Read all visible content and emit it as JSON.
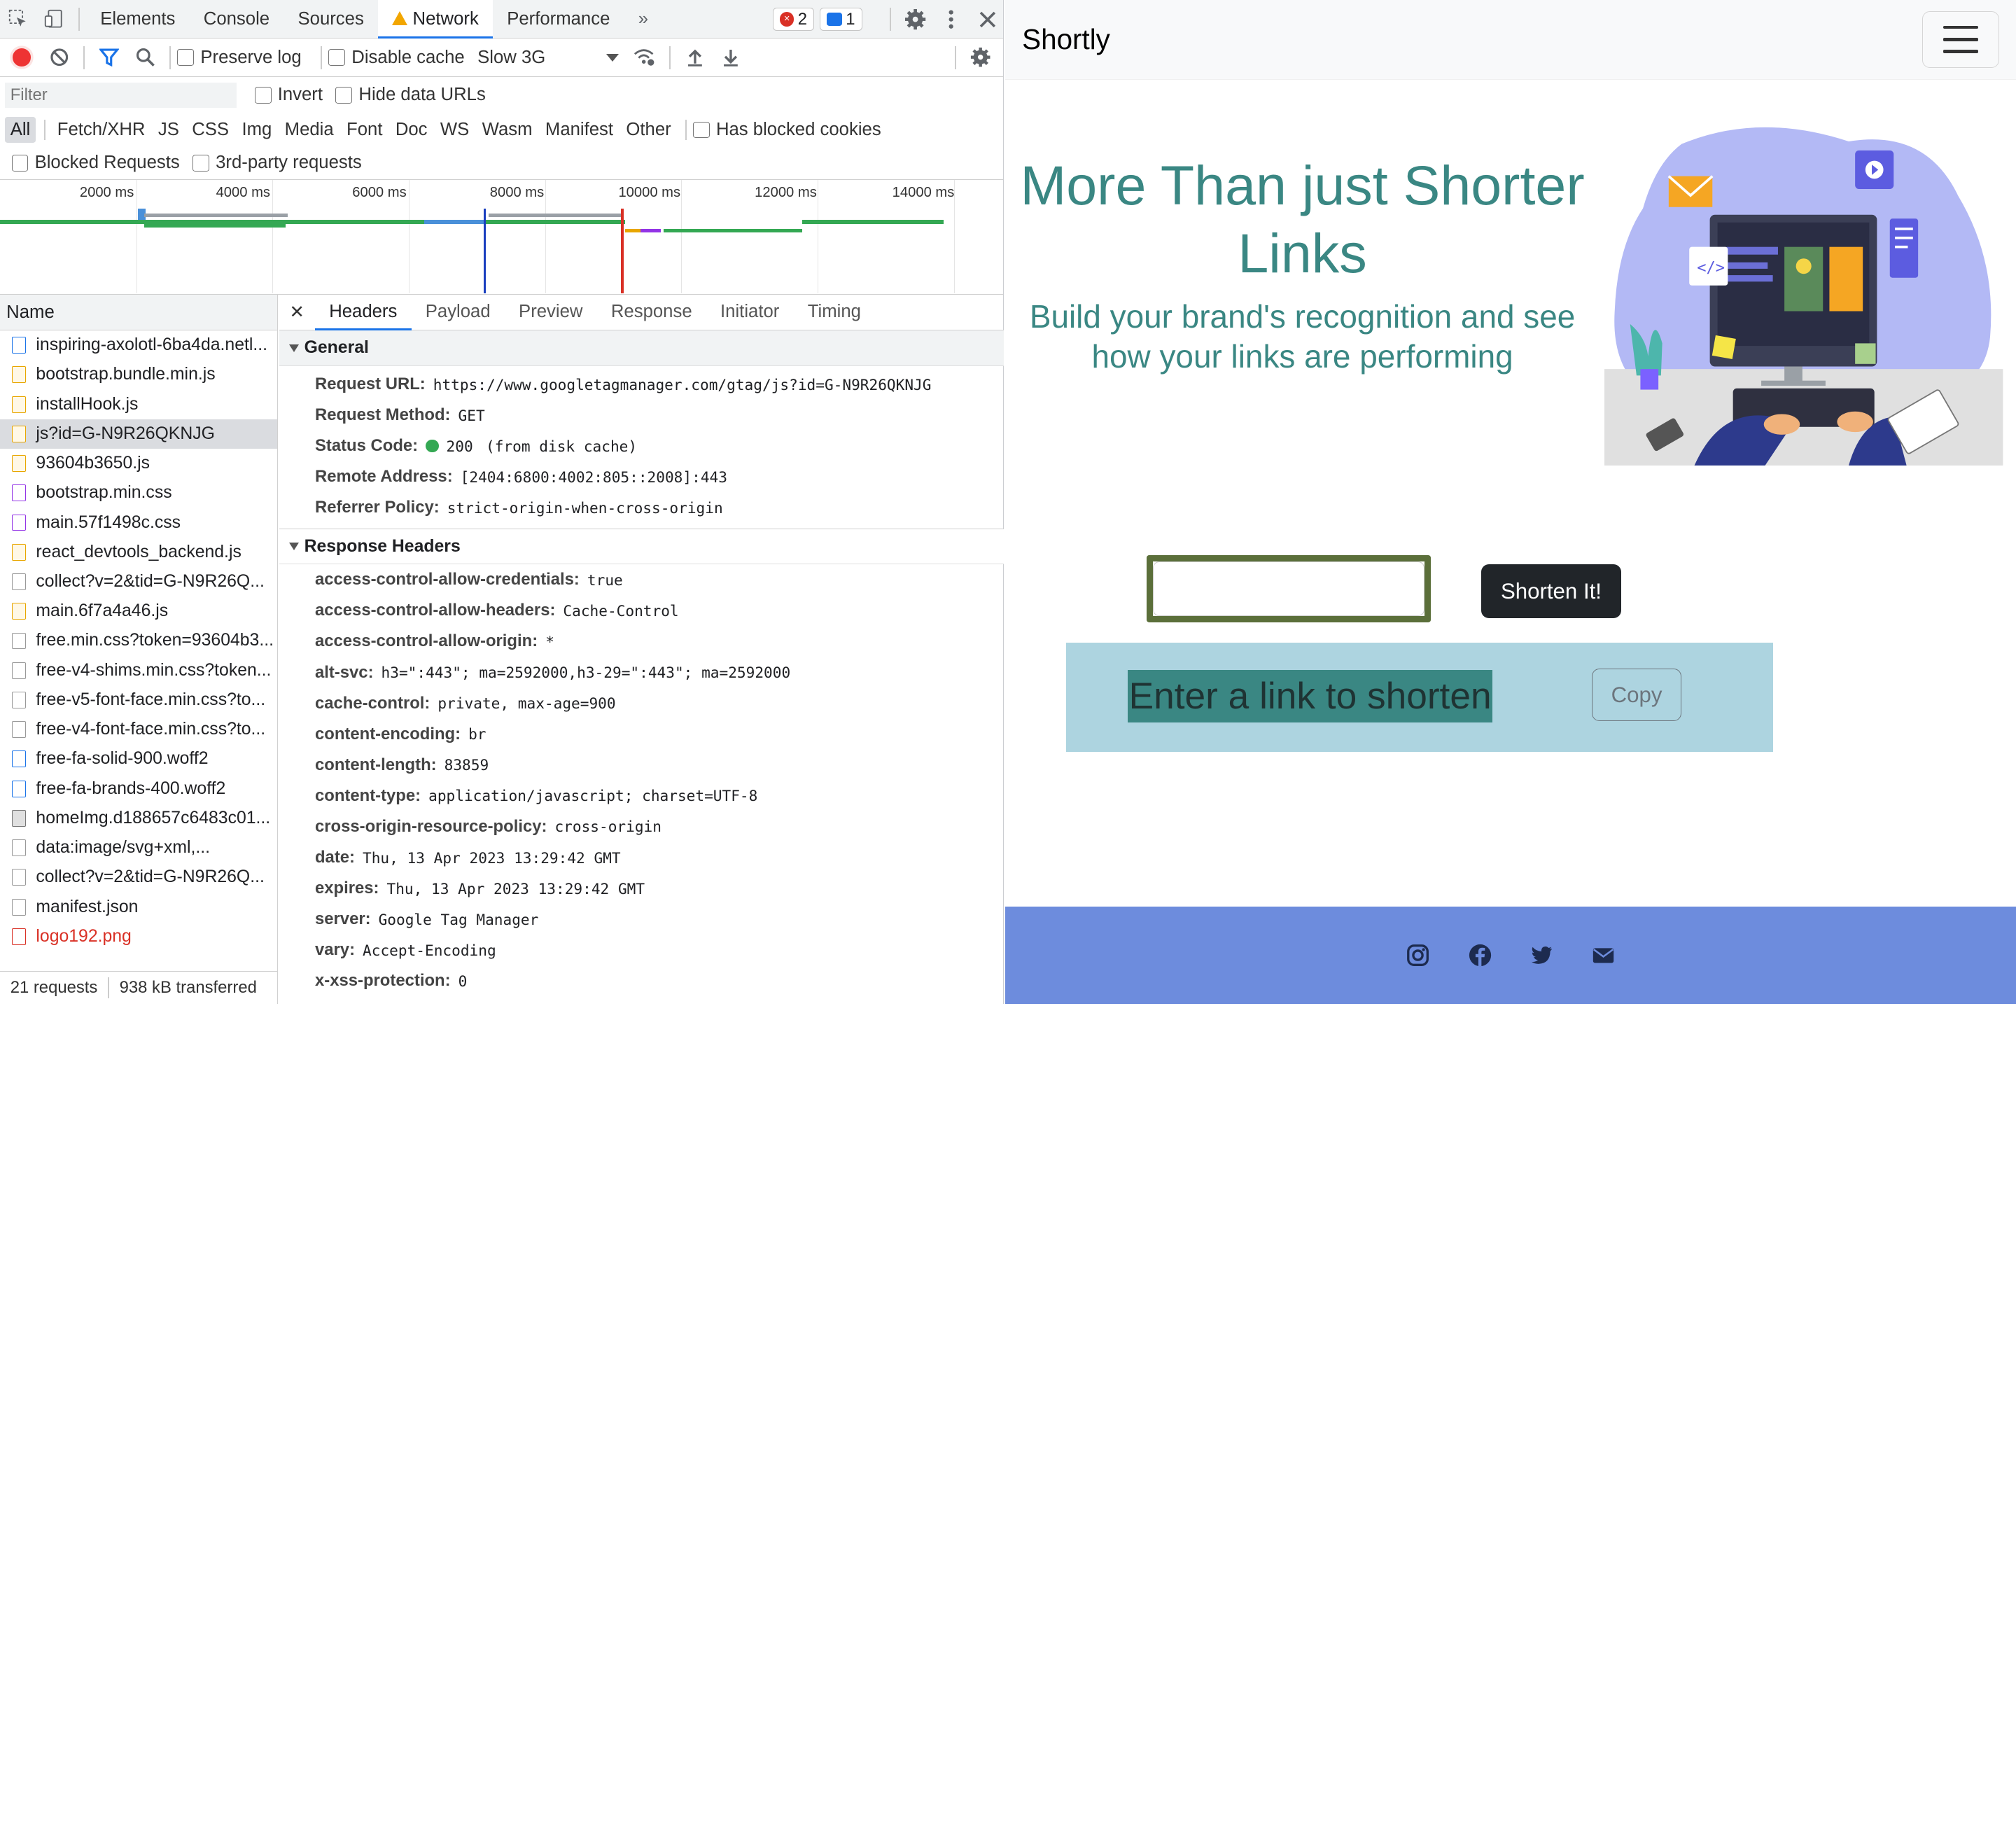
{
  "devtools": {
    "tabs": [
      "Elements",
      "Console",
      "Sources",
      "Network",
      "Performance"
    ],
    "more_tabs": "»",
    "error_count": "2",
    "message_count": "1",
    "toolbar": {
      "preserve_log": "Preserve log",
      "disable_cache": "Disable cache",
      "throttling": "Slow 3G"
    },
    "filter": {
      "placeholder": "Filter",
      "invert": "Invert",
      "hide_data_urls": "Hide data URLs"
    },
    "types": [
      "All",
      "Fetch/XHR",
      "JS",
      "CSS",
      "Img",
      "Media",
      "Font",
      "Doc",
      "WS",
      "Wasm",
      "Manifest",
      "Other"
    ],
    "has_blocked_cookies": "Has blocked cookies",
    "blocked_requests": "Blocked Requests",
    "third_party": "3rd-party requests",
    "timeline_ticks": [
      "2000 ms",
      "4000 ms",
      "6000 ms",
      "8000 ms",
      "10000 ms",
      "12000 ms",
      "14000 ms"
    ],
    "name_header": "Name",
    "requests": [
      {
        "name": "inspiring-axolotl-6ba4da.netl...",
        "kind": "doc"
      },
      {
        "name": "bootstrap.bundle.min.js",
        "kind": "js"
      },
      {
        "name": "installHook.js",
        "kind": "js"
      },
      {
        "name": "js?id=G-N9R26QKNJG",
        "kind": "js"
      },
      {
        "name": "93604b3650.js",
        "kind": "js"
      },
      {
        "name": "bootstrap.min.css",
        "kind": "css"
      },
      {
        "name": "main.57f1498c.css",
        "kind": "css"
      },
      {
        "name": "react_devtools_backend.js",
        "kind": "js"
      },
      {
        "name": "collect?v=2&tid=G-N9R26Q...",
        "kind": "other"
      },
      {
        "name": "main.6f7a4a46.js",
        "kind": "js"
      },
      {
        "name": "free.min.css?token=93604b3...",
        "kind": "other"
      },
      {
        "name": "free-v4-shims.min.css?token...",
        "kind": "other"
      },
      {
        "name": "free-v5-font-face.min.css?to...",
        "kind": "other"
      },
      {
        "name": "free-v4-font-face.min.css?to...",
        "kind": "other"
      },
      {
        "name": "free-fa-solid-900.woff2",
        "kind": "font"
      },
      {
        "name": "free-fa-brands-400.woff2",
        "kind": "font"
      },
      {
        "name": "homeImg.d188657c6483c01...",
        "kind": "img"
      },
      {
        "name": "data:image/svg+xml,...",
        "kind": "other"
      },
      {
        "name": "collect?v=2&tid=G-N9R26Q...",
        "kind": "other"
      },
      {
        "name": "manifest.json",
        "kind": "other"
      },
      {
        "name": "logo192.png",
        "kind": "red"
      }
    ],
    "footer": {
      "requests": "21 requests",
      "transferred": "938 kB transferred"
    },
    "detail_tabs": [
      "Headers",
      "Payload",
      "Preview",
      "Response",
      "Initiator",
      "Timing"
    ],
    "general_title": "General",
    "general": [
      {
        "k": "Request URL:",
        "v": "https://www.googletagmanager.com/gtag/js?id=G-N9R26QKNJG"
      },
      {
        "k": "Request Method:",
        "v": "GET"
      },
      {
        "k": "Status Code:",
        "v": "200",
        "extra": "(from disk cache)"
      },
      {
        "k": "Remote Address:",
        "v": "[2404:6800:4002:805::2008]:443"
      },
      {
        "k": "Referrer Policy:",
        "v": "strict-origin-when-cross-origin"
      }
    ],
    "response_title": "Response Headers",
    "response_headers": [
      {
        "k": "access-control-allow-credentials:",
        "v": "true"
      },
      {
        "k": "access-control-allow-headers:",
        "v": "Cache-Control"
      },
      {
        "k": "access-control-allow-origin:",
        "v": "*"
      },
      {
        "k": "alt-svc:",
        "v": "h3=\":443\"; ma=2592000,h3-29=\":443\"; ma=2592000"
      },
      {
        "k": "cache-control:",
        "v": "private, max-age=900"
      },
      {
        "k": "content-encoding:",
        "v": "br"
      },
      {
        "k": "content-length:",
        "v": "83859"
      },
      {
        "k": "content-type:",
        "v": "application/javascript; charset=UTF-8"
      },
      {
        "k": "cross-origin-resource-policy:",
        "v": "cross-origin"
      },
      {
        "k": "date:",
        "v": "Thu, 13 Apr 2023 13:29:42 GMT"
      },
      {
        "k": "expires:",
        "v": "Thu, 13 Apr 2023 13:29:42 GMT"
      },
      {
        "k": "server:",
        "v": "Google Tag Manager"
      },
      {
        "k": "vary:",
        "v": "Accept-Encoding"
      },
      {
        "k": "x-xss-protection:",
        "v": "0"
      }
    ]
  },
  "page": {
    "brand": "Shortly",
    "hero_title": "More Than just Shorter Links",
    "hero_subtitle": "Build your brand's recognition and see how your links are performing",
    "input_value": "",
    "shorten_button": "Shorten It!",
    "result_text": "Enter a link to shorten",
    "copy_button": "Copy",
    "footer_icons": [
      "instagram-icon",
      "facebook-icon",
      "twitter-icon",
      "envelope-icon"
    ],
    "colors": {
      "accent": "#3a8783",
      "footer": "#6d8cdd",
      "result_bg": "#add4e0",
      "button": "#212529"
    }
  }
}
